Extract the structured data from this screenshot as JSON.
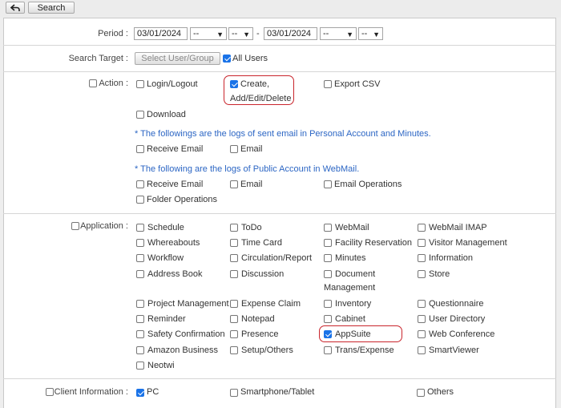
{
  "toolbar": {
    "back_icon": "back-arrow-icon",
    "search_label": "Search"
  },
  "period": {
    "label": "Period :",
    "from_date": "03/01/2024",
    "from_hour": "--",
    "from_minute": "--",
    "separator": "-",
    "to_date": "03/01/2024",
    "to_hour": "--",
    "to_minute": "--"
  },
  "search_target": {
    "label": "Search Target :",
    "select_button": "Select User/Group",
    "all_users": "All Users"
  },
  "action": {
    "label": "Action :",
    "login_logout": "Login/Logout",
    "create_line1": "Create,",
    "create_line2": "Add/Edit/Delete",
    "export_csv": "Export CSV",
    "download": "Download",
    "note_personal": "* The followings are the logs of sent email in Personal Account and Minutes.",
    "personal_receive_email": "Receive Email",
    "personal_email": "Email",
    "note_public": "* The following are the logs of Public Account in WebMail.",
    "public_receive_email": "Receive Email",
    "public_email": "Email",
    "email_operations": "Email Operations",
    "folder_operations": "Folder Operations"
  },
  "application": {
    "label": "Application :",
    "items": [
      "Schedule",
      "ToDo",
      "WebMail",
      "WebMail IMAP",
      "Whereabouts",
      "Time Card",
      "Facility Reservation",
      "Visitor Management",
      "Workflow",
      "Circulation/Report",
      "Minutes",
      "Information",
      "Address Book",
      "Discussion",
      "Document",
      "Store",
      "Project Management",
      "Expense Claim",
      "Inventory",
      "Questionnaire",
      "Reminder",
      "Notepad",
      "Cabinet",
      "User Directory",
      "Safety Confirmation",
      "Presence",
      "AppSuite",
      "Web Conference",
      "Amazon Business",
      "Setup/Others",
      "Trans/Expense",
      "SmartViewer",
      "Neotwi"
    ],
    "document_line2": "Management"
  },
  "client_information": {
    "label": "Client Information :",
    "pc": "PC",
    "smartphone": "Smartphone/Tablet",
    "others": "Others"
  },
  "colors": {
    "highlight": "#c9252c",
    "checked": "#1a73e8",
    "note": "#2c66c4"
  }
}
